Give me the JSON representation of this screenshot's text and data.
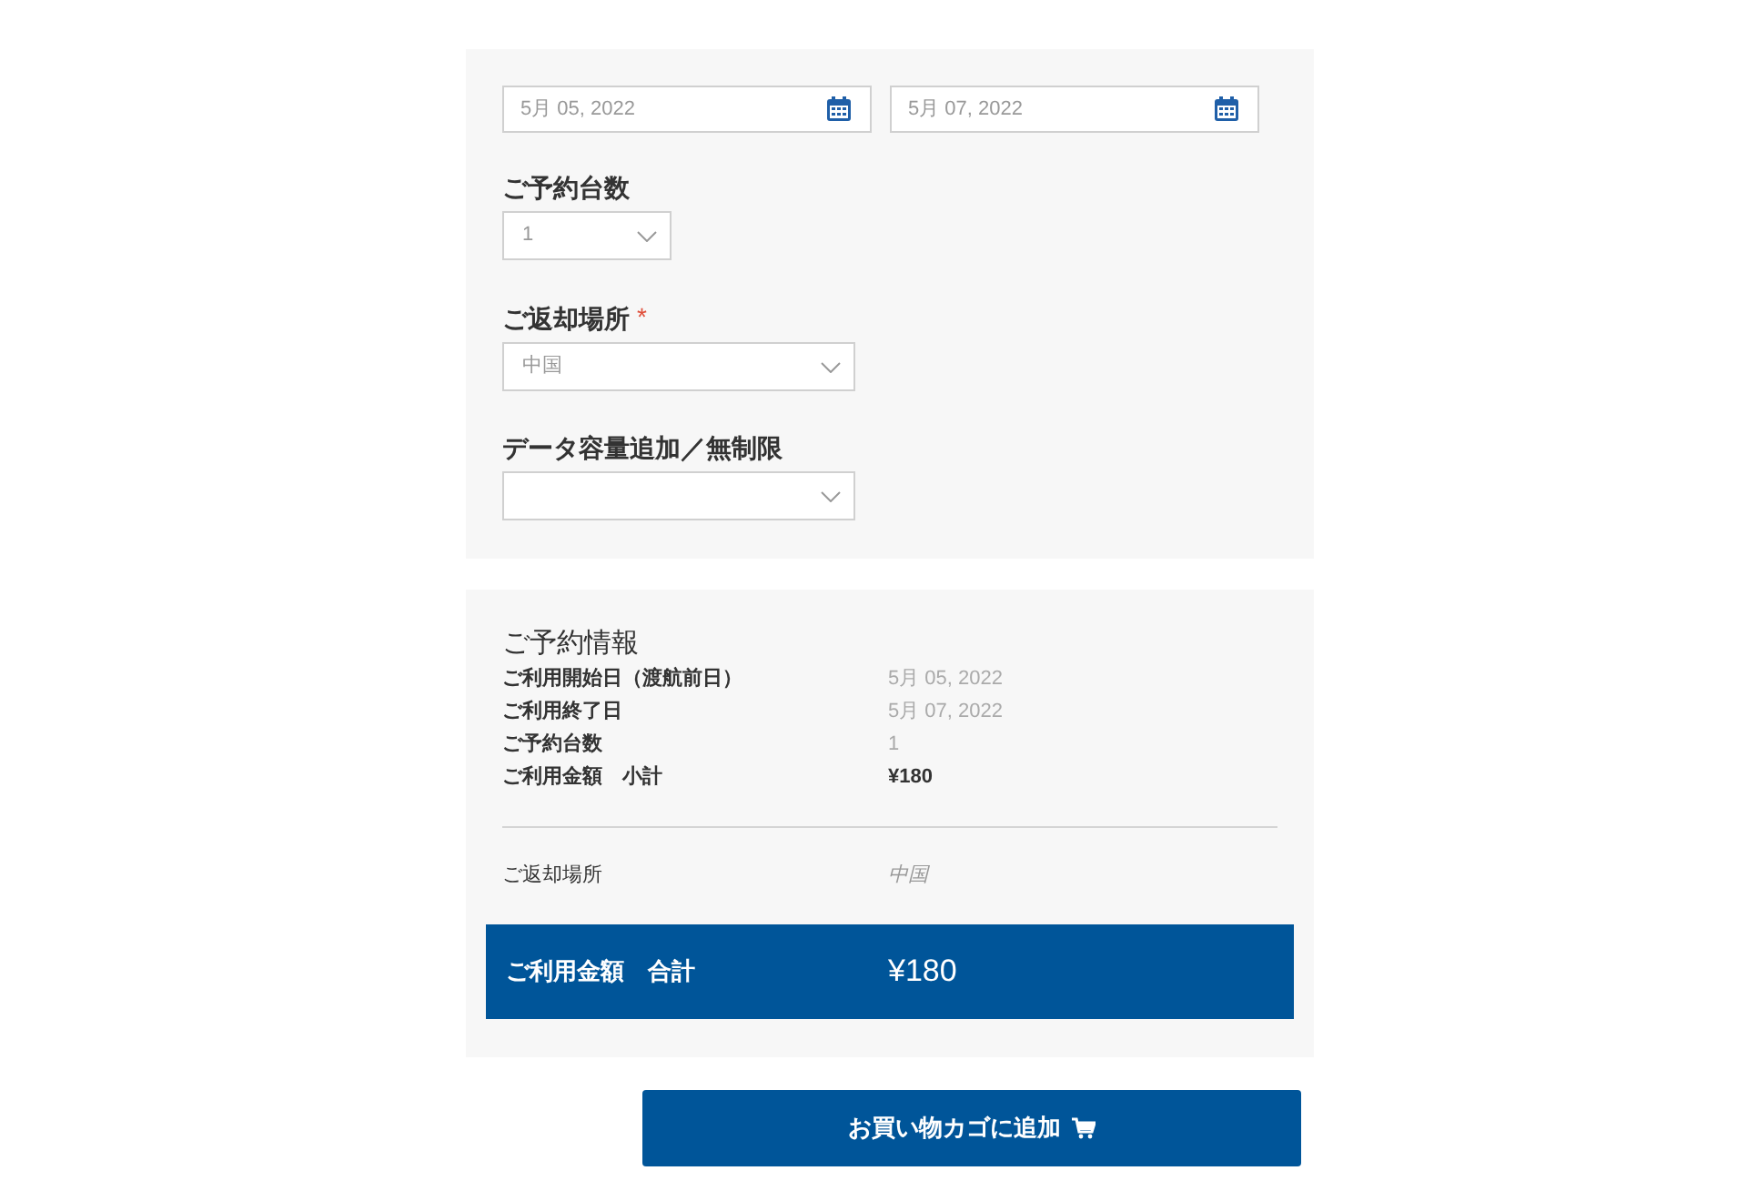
{
  "date_fields": [
    {
      "value": "5月 05, 2022"
    },
    {
      "value": "5月 07, 2022"
    }
  ],
  "selects": [
    {
      "label": "ご予約台数",
      "value": "1",
      "kind": "short"
    },
    {
      "label": "ご返却場所",
      "required_mark": "*",
      "value": "中国",
      "kind": "long"
    },
    {
      "label": "データ容量追加／無制限",
      "kind": "long"
    }
  ],
  "summary": {
    "title": "ご予約情報",
    "rows": [
      {
        "label": "ご利用開始日（渡航前日）",
        "value": "5月 05, 2022",
        "kind": "plain"
      },
      {
        "label": "ご利用終了日",
        "value": "5月 07, 2022",
        "kind": "plain"
      },
      {
        "label": "ご予約台数",
        "value": "1",
        "kind": "plain"
      },
      {
        "label": "ご利用金額　小計",
        "value": "¥180",
        "kind": "strong"
      }
    ],
    "return_row": {
      "label": "ご返却場所",
      "value": "中国"
    },
    "total": {
      "label": "ご利用金額　合計",
      "value": "¥180"
    }
  },
  "cart_button": {
    "label": "お買い物カゴに追加"
  }
}
